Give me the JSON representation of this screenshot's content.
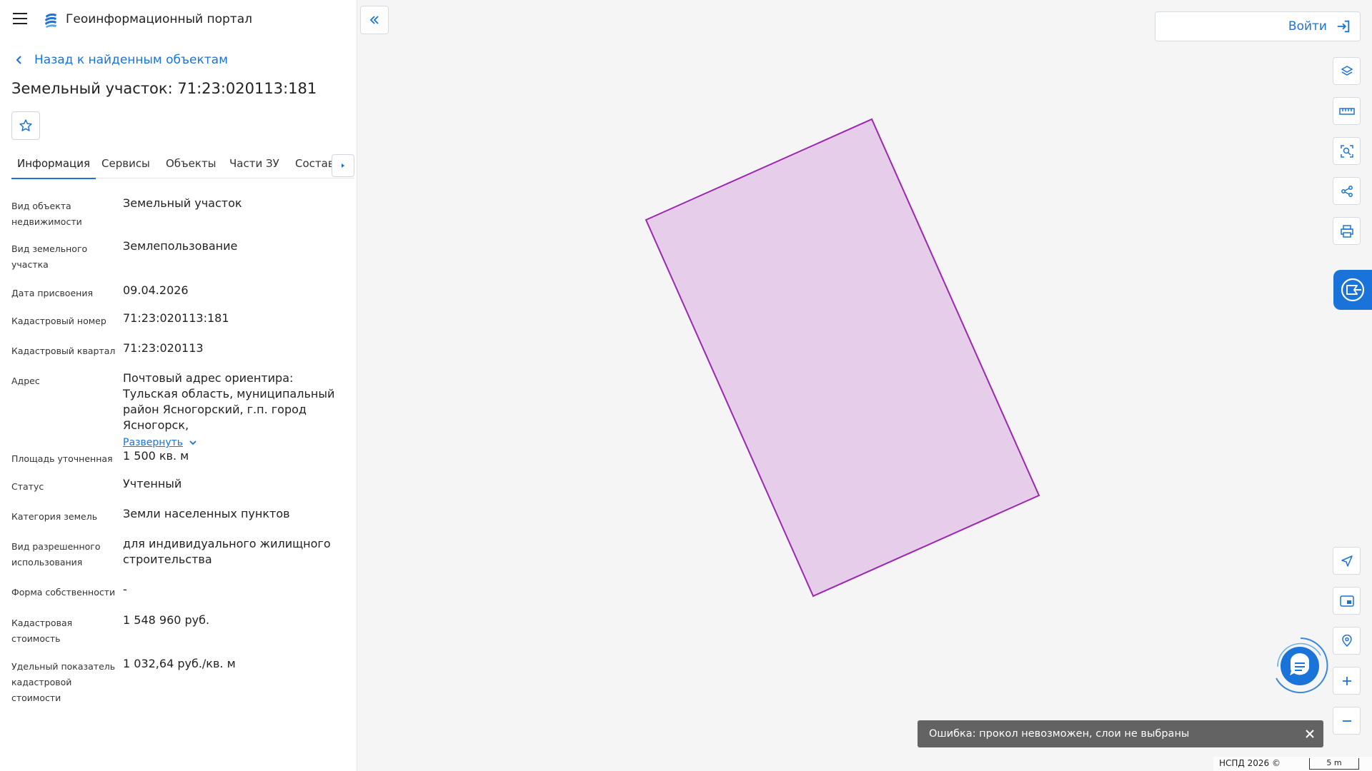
{
  "app": {
    "title": "Геоинформационный портал"
  },
  "panel": {
    "back_label": "Назад к найденным объектам",
    "object_title": "Земельный участок: 71:23:020113:181",
    "tabs": [
      {
        "label": "Информация"
      },
      {
        "label": "Сервисы"
      },
      {
        "label": "Объекты"
      },
      {
        "label": "Части ЗУ"
      },
      {
        "label": "Состав"
      }
    ],
    "properties": [
      {
        "label": "Вид объекта недвижимости",
        "value": "Земельный участок"
      },
      {
        "label": "Вид земельного участка",
        "value": "Землепользование"
      },
      {
        "label": "Дата присвоения",
        "value": "09.04.2026"
      },
      {
        "label": "Кадастровый номер",
        "value": "71:23:020113:181"
      },
      {
        "label": "Кадастровый квартал",
        "value": "71:23:020113"
      },
      {
        "label": "Адрес",
        "value": "Почтовый адрес ориентира: Тульская область, муниципальный район Ясногорский, г.п. город Ясногорск,",
        "expand_label": "Развернуть"
      },
      {
        "label": "Площадь уточненная",
        "value": "1 500 кв. м"
      },
      {
        "label": "Статус",
        "value": "Учтенный"
      },
      {
        "label": "Категория земель",
        "value": "Земли населенных пунктов"
      },
      {
        "label": "Вид разрешенного использования",
        "value": "для индивидуального жилищного строительства"
      },
      {
        "label": "Форма собственности",
        "value": "-"
      },
      {
        "label": "Кадастровая стоимость",
        "value": "1 548 960 руб."
      },
      {
        "label": "Удельный показатель кадастровой стоимости",
        "value": "1 032,64 руб./кв. м"
      }
    ]
  },
  "map": {
    "login_label": "Войти",
    "parcel_fill": "#e6cde9",
    "parcel_stroke": "#9c27b0",
    "accent": "#1a73d9",
    "toast_text": "Ошибка: прокол невозможен, слои не выбраны",
    "copyright": "НСПД 2026 ©",
    "scale_label": "5 m",
    "tools_top": [
      "layers-icon",
      "ruler-icon",
      "select-area-icon",
      "share-icon",
      "print-icon"
    ],
    "tools_bottom": [
      "navigate-icon",
      "picture-in-picture-icon",
      "location-search-icon",
      "zoom-in-icon",
      "zoom-out-icon"
    ]
  }
}
